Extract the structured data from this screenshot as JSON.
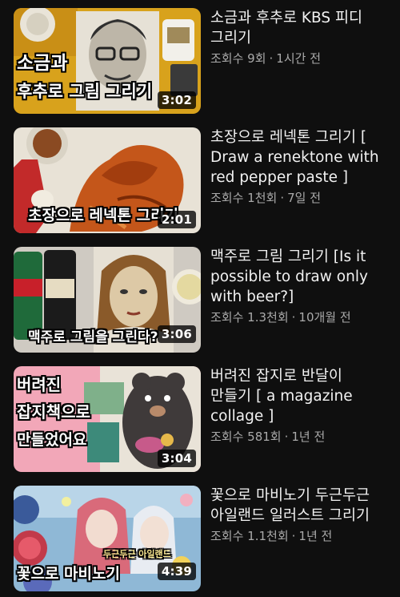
{
  "videos": [
    {
      "title": "소금과 후추로 KBS 피디 그리기",
      "views": "조회수 9회",
      "age": "1시간 전",
      "duration": "3:02",
      "overlay_line1": "소금과",
      "overlay_line2": "후추로 그림 그리기",
      "colors": {
        "bg": "#d8a21c",
        "accent": "#444444"
      }
    },
    {
      "title": "초장으로 레넥톤 그리기 [ Draw a renektone with red pepper paste ]",
      "views": "조회수 1천회",
      "age": "7일 전",
      "duration": "2:01",
      "overlay_line1": "초장으로 레넥톤 그리기",
      "colors": {
        "bg": "#e8e2d6",
        "accent": "#c4561a"
      }
    },
    {
      "title": "맥주로 그림 그리기 [Is it possible to draw only with beer?]",
      "views": "조회수 1.3천회",
      "age": "10개월 전",
      "duration": "3:06",
      "overlay_line1": "맥주로 그림을 그린다?",
      "colors": {
        "bg": "#cfcac2",
        "accent": "#b9853f"
      }
    },
    {
      "title": "버려진 잡지로 반달이 만들기 [ a magazine collage ]",
      "views": "조회수 581회",
      "age": "1년 전",
      "duration": "3:04",
      "overlay_line1": "버려진",
      "overlay_line2": "잡지책으로",
      "overlay_line3": "만들었어요",
      "colors": {
        "bg": "#f2a7b8",
        "accent": "#3f3a3a"
      }
    },
    {
      "title": "꽃으로 마비노기 두근두근 아일랜드 일러스트 그리기",
      "views": "조회수 1.1천회",
      "age": "1년 전",
      "duration": "4:39",
      "overlay_line1": "꽃으로 마비노기",
      "overlay_tag": "두근두근 아일랜드",
      "colors": {
        "bg": "#8fb8d6",
        "accent": "#d96a7a"
      }
    }
  ]
}
